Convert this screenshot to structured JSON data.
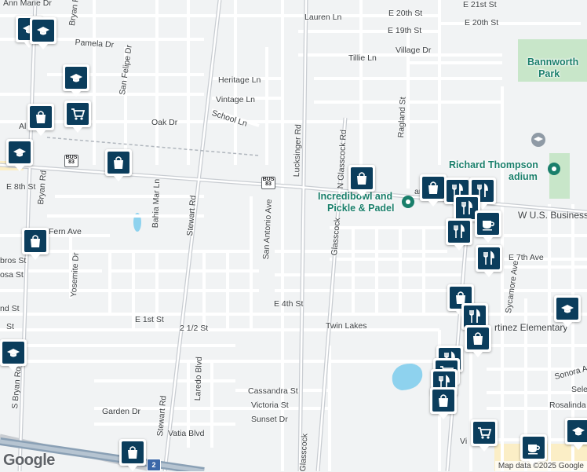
{
  "map": {
    "streets": {
      "anna_marie": "Ann Marie Dr",
      "bryan_rd_top": "Bryan Rd",
      "pamela": "Pamela Dr",
      "san_felipe": "San Felipe Dr",
      "lauren": "Lauren Ln",
      "e20th_a": "E 20th St",
      "e21st": "E 21st St",
      "e20th_b": "E 20th St",
      "e19th": "E 19th St",
      "tillie": "Tillie Ln",
      "village": "Village Dr",
      "heritage": "Heritage Ln",
      "vintage": "Vintage Ln",
      "oak": "Oak Dr",
      "school": "School Ln",
      "lucksinger": "Lucksinger Rd",
      "glasscock_n": "N Glasscock Rd",
      "ragland": "Ragland St",
      "e8th": "E 8th St",
      "bryan_rd": "Bryan Rd",
      "bahia_mar": "Bahia Mar Ln",
      "stewart_rd": "Stewart Rd",
      "san_antonio": "San Antonio Ave",
      "fern": "Fern Ave",
      "yosemite": "Yosemite Dr",
      "bros": "bros St",
      "osa": "osa St",
      "glasscock_mid": "Glasscock",
      "wus_business": "W U.S. Business",
      "e7th": "E 7th Ave",
      "sycamore": "Sycamore Ave",
      "e4th": "E 4th St",
      "nd_st": "nd St",
      "st_left": "St",
      "e1st": "E 1st St",
      "two_half": "2 1/2 St",
      "twin_lakes": "Twin Lakes",
      "s_bryan": "S Bryan Rd",
      "laredo": "Laredo Blvd",
      "stewart_low": "Stewart Rd",
      "cassandra": "Cassandra St",
      "victoria": "Victoria St",
      "garden": "Garden Dr",
      "sunset": "Sunset Dr",
      "vatia": "Vatia Blvd",
      "glasscock_low": "Glasscock",
      "sonora": "Sonora Av",
      "rosalinda": "Rosalinda",
      "sele": "Sele",
      "vi": "Vi",
      "al": "Al",
      "ant": "ant"
    },
    "places": {
      "bannworth_1": "Bannworth",
      "bannworth_2": "Park",
      "richard_1": "Richard Thompson",
      "richard_2": "adium",
      "incredibowl_1": "Incredibowl and",
      "incredibowl_2": "Pickle & Padel",
      "martinez": "rtinez Elementary"
    },
    "shields": {
      "bus83_top": "BUS",
      "bus83_num": "83",
      "bus83b_top": "BUS",
      "bus83b_num": "83",
      "i2": "2"
    },
    "markers": [
      {
        "icon": "school-icon"
      },
      {
        "icon": "school-icon"
      },
      {
        "icon": "school-icon"
      },
      {
        "icon": "shopping-bag-icon"
      },
      {
        "icon": "shopping-cart-icon"
      },
      {
        "icon": "school-icon"
      },
      {
        "icon": "shopping-bag-icon"
      },
      {
        "icon": "shopping-bag-icon"
      },
      {
        "icon": "shopping-bag-icon"
      },
      {
        "icon": "shopping-bag-icon"
      },
      {
        "icon": "restaurant-icon"
      },
      {
        "icon": "restaurant-icon"
      },
      {
        "icon": "restaurant-icon"
      },
      {
        "icon": "cafe-icon"
      },
      {
        "icon": "restaurant-icon"
      },
      {
        "icon": "restaurant-icon"
      },
      {
        "icon": "shopping-bag-icon"
      },
      {
        "icon": "school-icon"
      },
      {
        "icon": "restaurant-icon"
      },
      {
        "icon": "shopping-bag-icon"
      },
      {
        "icon": "restaurant-icon"
      },
      {
        "icon": "shopping-cart-icon"
      },
      {
        "icon": "restaurant-icon"
      },
      {
        "icon": "shopping-bag-icon"
      },
      {
        "icon": "shopping-cart-icon"
      },
      {
        "icon": "cafe-icon"
      },
      {
        "icon": "school-icon"
      },
      {
        "icon": "shopping-bag-icon"
      },
      {
        "icon": "school-icon"
      }
    ],
    "colors": {
      "background": "#f1f3f4",
      "road": "#ffffff",
      "major_road": "#c9cdd2",
      "park": "#c8e6c9",
      "water": "#8ed2ee",
      "marker": "#0b3d5c",
      "poi_green": "#1a7f6b"
    },
    "attribution": "Map data ©2025 Google",
    "logo": "Google"
  }
}
